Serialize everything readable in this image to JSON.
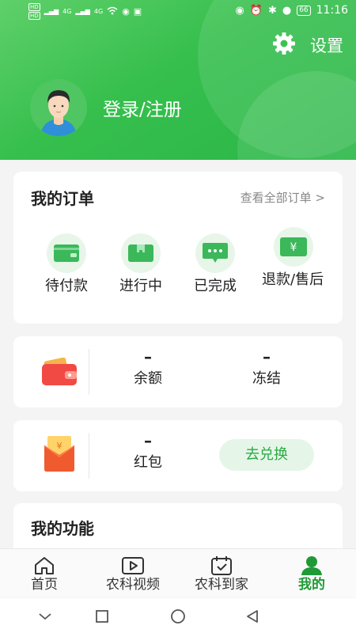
{
  "status_bar": {
    "left_tags": [
      "HD",
      "HD"
    ],
    "signal1": "4G",
    "signal2": "4G",
    "battery": "66",
    "time": "11:16"
  },
  "header": {
    "settings_label": "设置",
    "login_label": "登录/注册",
    "colors": {
      "primary": "#36bf4d",
      "accent_dark": "#1f9a36"
    }
  },
  "orders": {
    "title": "我的订单",
    "view_all": "查看全部订单 >",
    "items": [
      {
        "label": "待付款",
        "icon": "wallet-card-icon"
      },
      {
        "label": "进行中",
        "icon": "package-icon"
      },
      {
        "label": "已完成",
        "icon": "chat-bubble-icon"
      },
      {
        "label": "退款/售后",
        "icon": "yen-icon"
      }
    ]
  },
  "wallet": {
    "balance_value": "–",
    "balance_label": "余额",
    "frozen_value": "–",
    "frozen_label": "冻结"
  },
  "redpack": {
    "value": "–",
    "label": "红包",
    "exchange_label": "去兑换"
  },
  "functions": {
    "title": "我的功能"
  },
  "tabbar": {
    "tabs": [
      {
        "label": "首页",
        "icon": "home-icon"
      },
      {
        "label": "农科视频",
        "icon": "video-icon"
      },
      {
        "label": "农科到家",
        "icon": "calendar-check-icon"
      },
      {
        "label": "我的",
        "icon": "person-icon",
        "active": true
      }
    ]
  }
}
